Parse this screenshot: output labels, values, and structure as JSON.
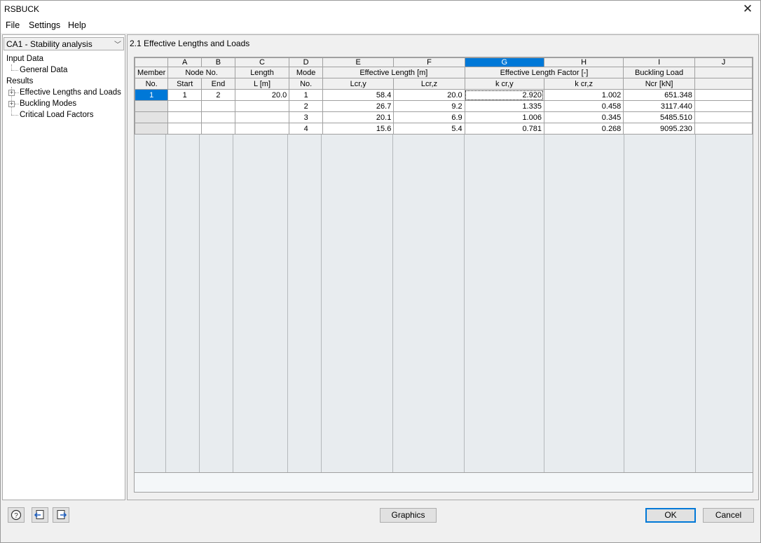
{
  "window": {
    "title": "RSBUCK",
    "close_icon": "close-icon"
  },
  "menu": [
    "File",
    "Settings",
    "Help"
  ],
  "case_selector": {
    "value": "CA1 - Stability analysis"
  },
  "tree": {
    "input_data": "Input Data",
    "general_data": "General Data",
    "results": "Results",
    "effective_lengths": "Effective Lengths and Loads",
    "buckling_modes": "Buckling Modes",
    "critical_load_factors": "Critical Load Factors"
  },
  "panel_title": "2.1 Effective Lengths and Loads",
  "table": {
    "column_letters": [
      "A",
      "B",
      "C",
      "D",
      "E",
      "F",
      "G",
      "H",
      "I",
      "J"
    ],
    "selected_column": "G",
    "headers": {
      "member": "Member",
      "member_no": "No.",
      "node_no": "Node No.",
      "start": "Start",
      "end": "End",
      "length": "Length",
      "length_unit": "L [m]",
      "mode": "Mode",
      "mode_no": "No.",
      "effective_length": "Effective Length [m]",
      "lcr_y": "Lcr,y",
      "lcr_z": "Lcr,z",
      "effective_length_factor": "Effective Length Factor [-]",
      "kcr_y": "k cr,y",
      "kcr_z": "k cr,z",
      "buckling_load": "Buckling Load",
      "ncr": "Ncr [kN]"
    },
    "rows": [
      {
        "member": "1",
        "start": "1",
        "end": "2",
        "length": "20.0",
        "mode": "1",
        "lcry": "58.4",
        "lcrz": "20.0",
        "kcry": "2.920",
        "kcrz": "1.002",
        "ncr": "651.348"
      },
      {
        "member": "",
        "start": "",
        "end": "",
        "length": "",
        "mode": "2",
        "lcry": "26.7",
        "lcrz": "9.2",
        "kcry": "1.335",
        "kcrz": "0.458",
        "ncr": "3117.440"
      },
      {
        "member": "",
        "start": "",
        "end": "",
        "length": "",
        "mode": "3",
        "lcry": "20.1",
        "lcrz": "6.9",
        "kcry": "1.006",
        "kcrz": "0.345",
        "ncr": "5485.510"
      },
      {
        "member": "",
        "start": "",
        "end": "",
        "length": "",
        "mode": "4",
        "lcry": "15.6",
        "lcrz": "5.4",
        "kcry": "0.781",
        "kcrz": "0.268",
        "ncr": "9095.230"
      }
    ]
  },
  "buttons": {
    "graphics": "Graphics",
    "ok": "OK",
    "cancel": "Cancel"
  },
  "icons": {
    "help": "help-icon",
    "import": "import-icon",
    "export": "export-icon"
  },
  "colors": {
    "selection": "#0078d7"
  }
}
